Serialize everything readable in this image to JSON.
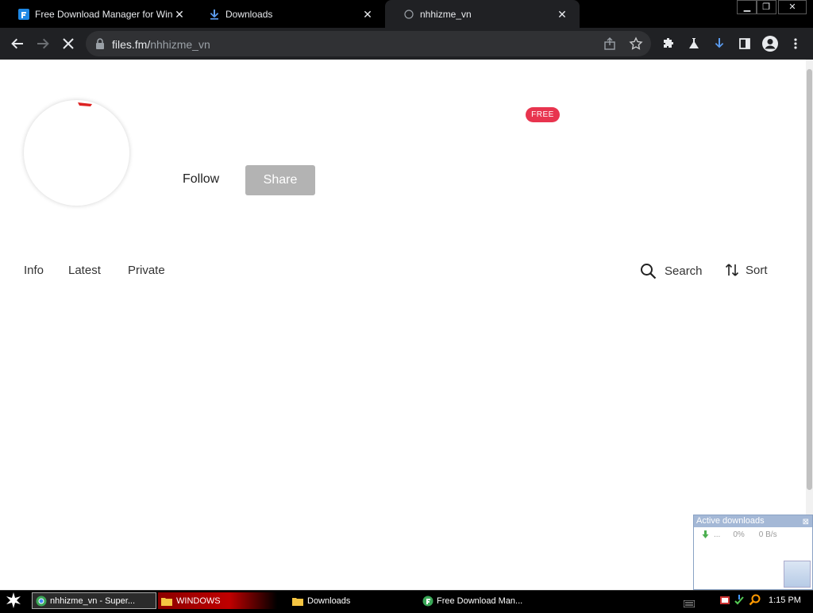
{
  "browser": {
    "tabs": [
      {
        "title": "Free Download Manager for Windows",
        "active": false,
        "favicon": "fdm-icon"
      },
      {
        "title": "Downloads",
        "active": false,
        "favicon": "download-icon"
      },
      {
        "title": "nhhizme_vn",
        "active": true,
        "favicon": "globe-icon"
      }
    ],
    "url_host": "files.fm/",
    "url_path": "nhhizme_vn"
  },
  "profile": {
    "badge": "FREE",
    "follow_label": "Follow",
    "share_label": "Share"
  },
  "nav": {
    "items": [
      "Info",
      "Latest",
      "Private"
    ],
    "search_label": "Search",
    "sort_label": "Sort"
  },
  "active_downloads": {
    "title": "Active downloads",
    "row_name": "...",
    "row_progress": "0%",
    "row_speed": "0 B/s"
  },
  "taskbar": {
    "items": [
      "nhhizme_vn - Super...",
      "WINDOWS",
      "Downloads",
      "Free Download Man..."
    ],
    "clock": "1:15 PM"
  },
  "colors": {
    "badge_red": "#e8344e",
    "share_gray": "#b3b3b3",
    "chrome_dark": "#202124"
  }
}
